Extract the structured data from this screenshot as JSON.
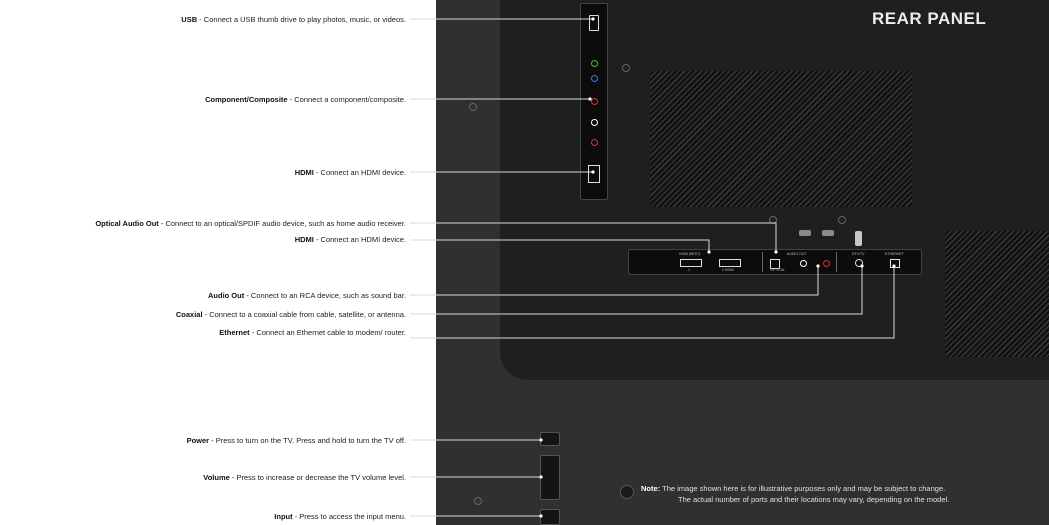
{
  "title": "REAR PANEL",
  "callouts": [
    {
      "id": "usb",
      "term": "USB",
      "desc": " - Connect a USB thumb drive to play photos, music, or videos."
    },
    {
      "id": "component",
      "term": "Component/Composite",
      "desc": " - Connect a component/composite."
    },
    {
      "id": "hdmi_side",
      "term": "HDMI",
      "desc": " - Connect an HDMI device."
    },
    {
      "id": "optical",
      "term": "Optical Audio Out",
      "desc": " - Connect to an optical/SPDIF audio device, such as home audio receiver."
    },
    {
      "id": "hdmi_rear",
      "term": "HDMI",
      "desc": " - Connect an HDMI device."
    },
    {
      "id": "audio_out",
      "term": "Audio Out",
      "desc": " -  Connect to an RCA device, such as sound bar."
    },
    {
      "id": "coaxial",
      "term": "Coaxial",
      "desc": " - Connect to a coaxial cable from cable, satellite, or antenna."
    },
    {
      "id": "ethernet",
      "term": "Ethernet",
      "desc": " - Connect an Ethernet cable to modem/ router."
    },
    {
      "id": "power",
      "term": "Power",
      "desc": " - Press to turn on the TV. Press and hold to turn the TV off."
    },
    {
      "id": "volume",
      "term": "Volume",
      "desc": " - Press to increase or decrease the TV volume level."
    },
    {
      "id": "input",
      "term": "Input",
      "desc": " - Press to access the input menu."
    }
  ],
  "note": {
    "label": "Note:",
    "line1": "The image shown here is for illustrative purposes only and may be subject to change.",
    "line2": "The actual number of ports and their locations may vary, depending on the model."
  },
  "port_labels": {
    "hdmi_group": "HDMI (BEST)",
    "hdmi1": "1",
    "hdmi2": "2 HDMI",
    "audio_out": "AUDIO OUT",
    "optical": "OPTICAL",
    "dtv_tv": "DTV/TV",
    "ethernet": "ETHERNET"
  }
}
